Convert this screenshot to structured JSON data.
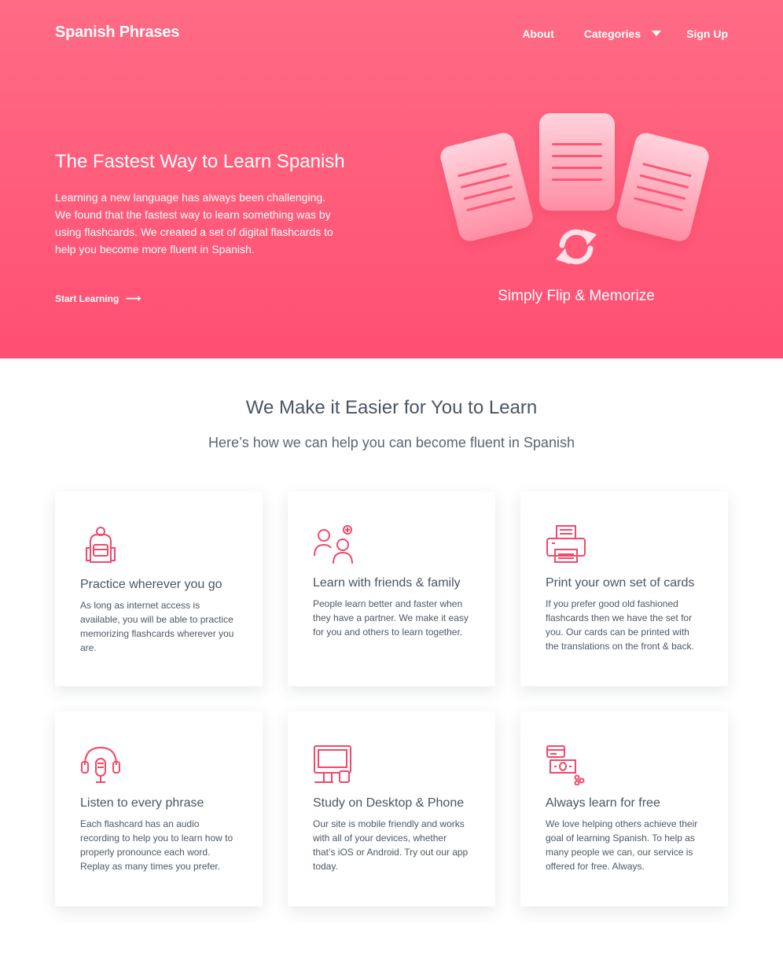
{
  "header": {
    "brand": "Spanish Phrases",
    "nav": {
      "about": "About",
      "categories": "Categories",
      "sign_up": "Sign Up"
    }
  },
  "hero": {
    "title": "The Fastest Way to Learn Spanish",
    "text": "Learning a new language has always been challenging. We found that the fastest way to learn something was by using flashcards. We created a set of digital flashcards to help you become more fluent in Spanish.",
    "cta": "Start Learning",
    "cta_arrow": "⟶",
    "art_caption": "Simply Flip & Memorize"
  },
  "section": {
    "title": "We Make it Easier for You to Learn",
    "subtitle": "Here’s how we can help you can become fluent in Spanish"
  },
  "features": [
    {
      "icon": "backpack-icon",
      "title": "Practice wherever you go",
      "text": "As long as internet access is available, you will be able to practice memorizing flashcards wherever you are."
    },
    {
      "icon": "people-add-icon",
      "title": "Learn with friends & family",
      "text": "People learn better and faster when they have a partner. We make it easy for you and others to learn together."
    },
    {
      "icon": "printer-icon",
      "title": "Print your own set of cards",
      "text": "If you prefer good old fashioned flashcards then we have the set for you. Our cards can be printed with the translations on the front & back."
    },
    {
      "icon": "headset-microphone-icon",
      "title": "Listen to every phrase",
      "text": "Each flashcard has an audio recording to help you to learn how to properly pronounce each word. Replay as many times you prefer."
    },
    {
      "icon": "desktop-phone-icon",
      "title": "Study on Desktop & Phone",
      "text": "Our site is mobile friendly and works with all of your devices, whether that’s iOS or Android. Try out our app today."
    },
    {
      "icon": "money-coins-icon",
      "title": "Always learn for free",
      "text": "We love helping others achieve their goal of learning Spanish. To help as many people we can, our service is offered for free. Always."
    }
  ],
  "colors": {
    "accent": "#ff5c7a",
    "icon": "#f2486b",
    "text": "#4a5562"
  }
}
